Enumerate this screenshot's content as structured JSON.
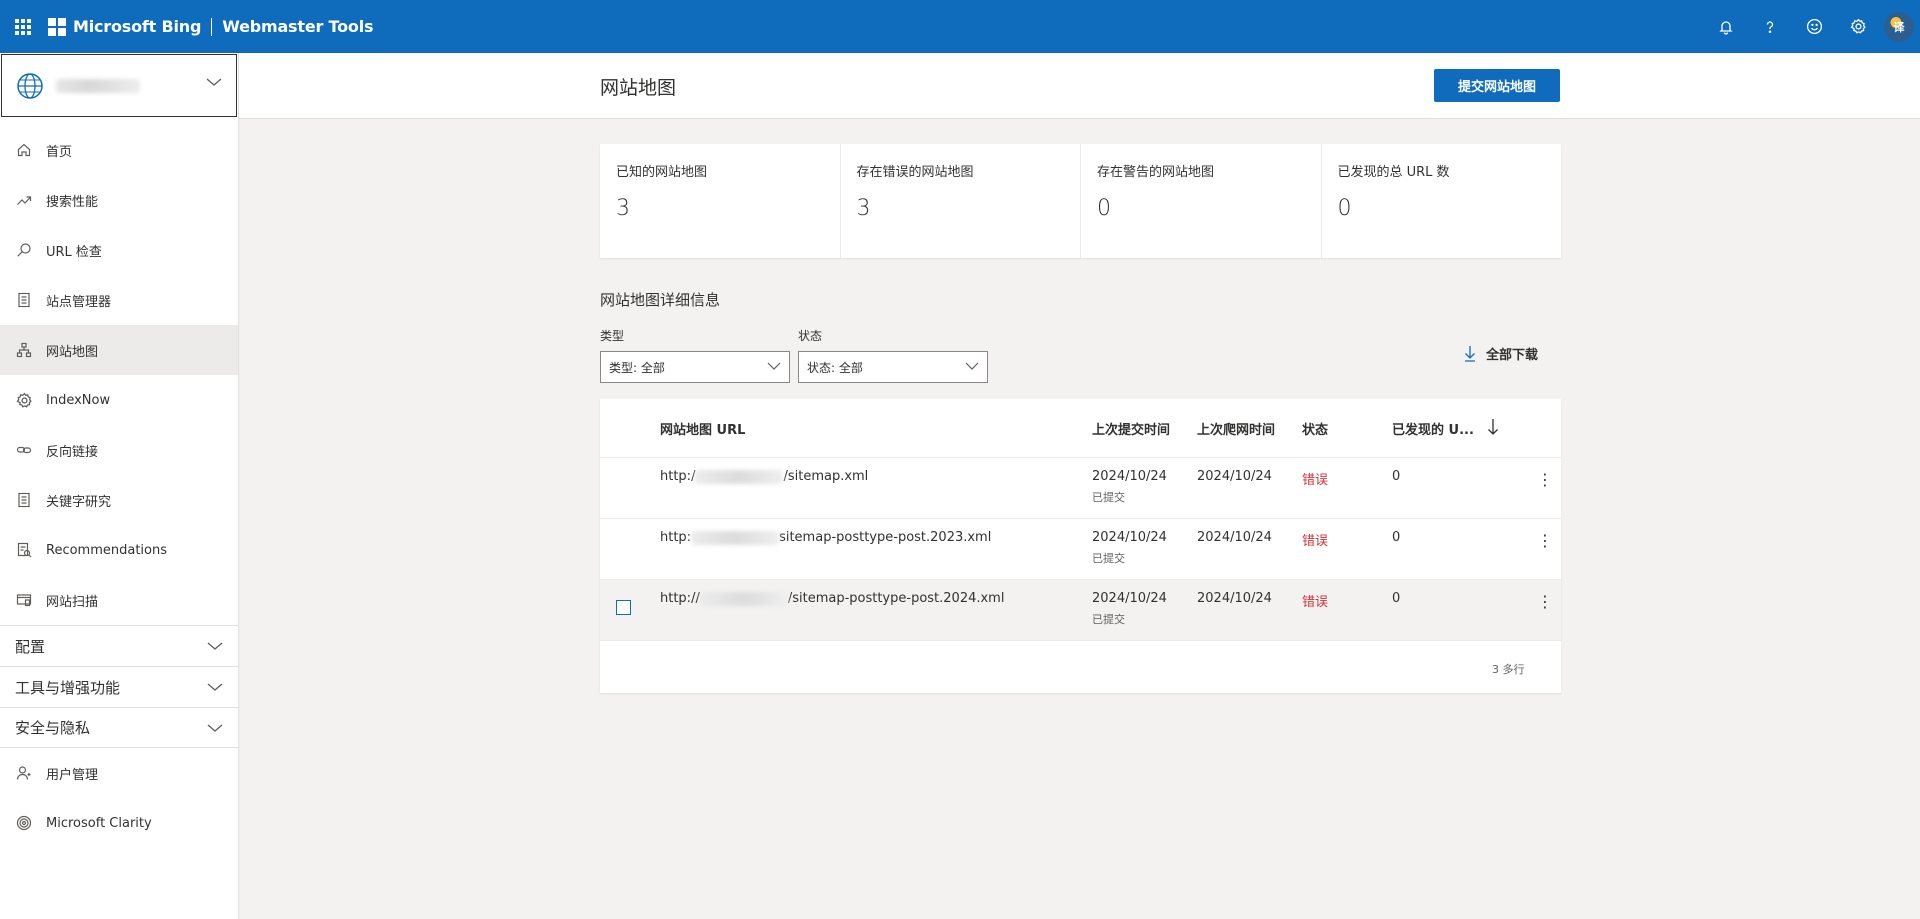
{
  "topbar": {
    "brand": "Microsoft Bing",
    "product": "Webmaster Tools",
    "avatar_text": "译",
    "icons": [
      "bell-icon",
      "help-icon",
      "smiley-icon",
      "gear-icon"
    ]
  },
  "sidebar": {
    "nav": [
      {
        "label": "首页",
        "icon": "home-icon"
      },
      {
        "label": "搜索性能",
        "icon": "trend-icon"
      },
      {
        "label": "URL 检查",
        "icon": "search-icon"
      },
      {
        "label": "站点管理器",
        "icon": "document-icon"
      },
      {
        "label": "网站地图",
        "icon": "sitemap-icon",
        "active": true
      },
      {
        "label": "IndexNow",
        "icon": "gear-icon"
      },
      {
        "label": "反向链接",
        "icon": "link-icon"
      },
      {
        "label": "关键字研究",
        "icon": "document-icon"
      },
      {
        "label": "Recommendations",
        "icon": "recommendations-icon"
      },
      {
        "label": "网站扫描",
        "icon": "scan-icon"
      }
    ],
    "groups": [
      "配置",
      "工具与增强功能",
      "安全与隐私"
    ],
    "bottom_nav": [
      {
        "label": "用户管理",
        "icon": "user-icon"
      },
      {
        "label": "Microsoft Clarity",
        "icon": "clarity-icon"
      }
    ]
  },
  "header": {
    "title": "网站地图",
    "submit_label": "提交网站地图"
  },
  "stats": [
    {
      "label": "已知的网站地图",
      "value": "3"
    },
    {
      "label": "存在错误的网站地图",
      "value": "3"
    },
    {
      "label": "存在警告的网站地图",
      "value": "0"
    },
    {
      "label": "已发现的总 URL 数",
      "value": "0"
    }
  ],
  "details": {
    "title": "网站地图详细信息",
    "filters": {
      "type_label": "类型",
      "type_value": "类型: 全部",
      "status_label": "状态",
      "status_value": "状态: 全部"
    },
    "download_label": "全部下载"
  },
  "table": {
    "columns": [
      "网站地图 URL",
      "上次提交时间",
      "上次爬网时间",
      "状态",
      "已发现的 U..."
    ],
    "rows": [
      {
        "url_prefix": "http:/",
        "url_suffix": "/sitemap.xml",
        "submitted": "2024/10/24",
        "submitted_note": "已提交",
        "crawled": "2024/10/24",
        "status": "错误",
        "discovered": "0"
      },
      {
        "url_prefix": "http:",
        "url_suffix": "sitemap-posttype-post.2023.xml",
        "submitted": "2024/10/24",
        "submitted_note": "已提交",
        "crawled": "2024/10/24",
        "status": "错误",
        "discovered": "0"
      },
      {
        "url_prefix": "http://",
        "url_suffix": "/sitemap-posttype-post.2024.xml",
        "submitted": "2024/10/24",
        "submitted_note": "已提交",
        "crawled": "2024/10/24",
        "status": "错误",
        "discovered": "0"
      }
    ],
    "footer": "3 多行"
  },
  "colors": {
    "accent": "#0f6cbd",
    "error": "#d13438",
    "background": "#f3f2f1"
  }
}
